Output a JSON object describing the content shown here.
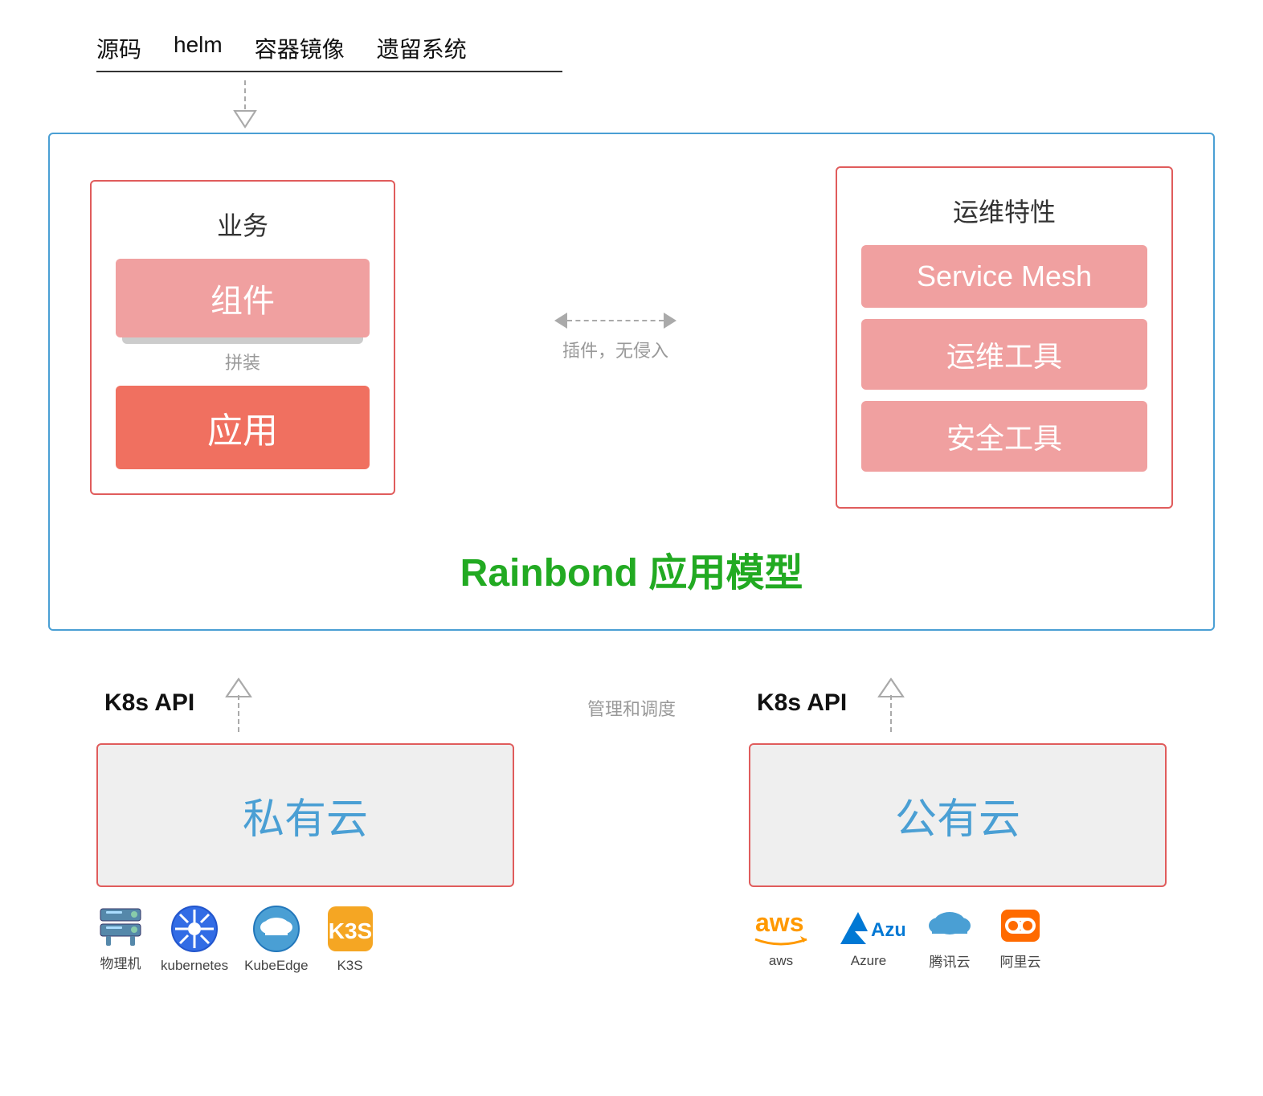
{
  "sources": {
    "items": [
      "源码",
      "helm",
      "容器镜像",
      "遗留系统"
    ]
  },
  "business": {
    "title": "业务",
    "component_label": "组件",
    "assemble_label": "拼装",
    "app_label": "应用"
  },
  "middleware": {
    "plugin_label": "插件，无侵入"
  },
  "ops": {
    "title": "运维特性",
    "items": [
      "Service Mesh",
      "运维工具",
      "安全工具"
    ]
  },
  "rainbond": {
    "title_en": "Rainbond",
    "title_cn": "应用模型"
  },
  "bottom": {
    "mgmt_label": "管理和调度",
    "left": {
      "k8s_label": "K8s API",
      "cloud_label": "私有云",
      "icons": [
        {
          "name": "物理机",
          "type": "server"
        },
        {
          "name": "kubernetes",
          "type": "k8s"
        },
        {
          "name": "KubeEdge",
          "type": "kubeedge"
        },
        {
          "name": "K3S",
          "type": "k3s"
        }
      ]
    },
    "right": {
      "k8s_label": "K8s API",
      "cloud_label": "公有云",
      "icons": [
        {
          "name": "aws",
          "type": "aws"
        },
        {
          "name": "Azure",
          "type": "azure"
        },
        {
          "name": "腾讯云",
          "type": "tencent"
        },
        {
          "name": "阿里云",
          "type": "aliyun"
        }
      ]
    }
  }
}
